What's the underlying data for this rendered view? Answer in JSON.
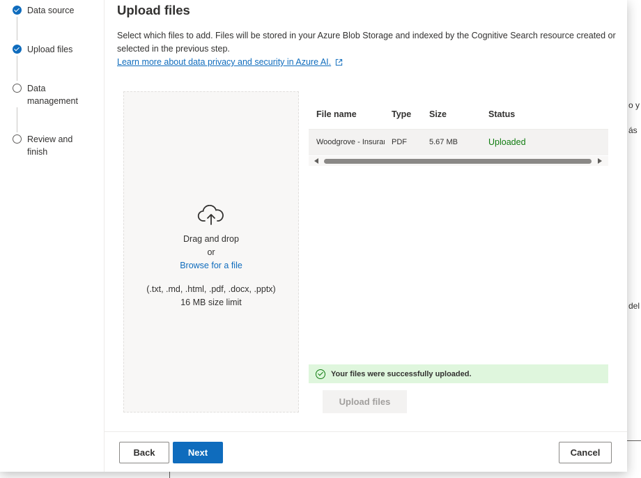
{
  "background": {
    "fragments": [
      "o y l",
      "ás",
      "del"
    ]
  },
  "stepper": {
    "steps": [
      {
        "label": "Data source",
        "state": "complete"
      },
      {
        "label": "Upload files",
        "state": "complete"
      },
      {
        "label": "Data management",
        "state": "pending"
      },
      {
        "label": "Review and finish",
        "state": "pending"
      }
    ]
  },
  "main": {
    "title": "Upload files",
    "description": "Select which files to add. Files will be stored in your Azure Blob Storage and indexed by the Cognitive Search resource created or selected in the previous step.",
    "learn_more_link": "Learn more about data privacy and security in Azure AI.",
    "external_icon": "external-link-icon"
  },
  "dropzone": {
    "icon": "cloud-upload-icon",
    "drag_text": "Drag and drop",
    "or_text": "or",
    "browse_text": "Browse for a file",
    "types_text": "(.txt, .md, .html, .pdf, .docx, .pptx)",
    "limit_text": "16 MB size limit"
  },
  "file_table": {
    "headers": {
      "name": "File name",
      "type": "Type",
      "size": "Size",
      "status": "Status"
    },
    "rows": [
      {
        "name": "Woodgrove - Insurance",
        "type": "PDF",
        "size": "5.67 MB",
        "status": "Uploaded"
      }
    ]
  },
  "success_message": "Your files were successfully uploaded.",
  "upload_button": "Upload files",
  "footer": {
    "back": "Back",
    "next": "Next",
    "cancel": "Cancel"
  },
  "colors": {
    "accent": "#0f6cbd",
    "success": "#107c10",
    "success_bg": "#dff6dd"
  }
}
